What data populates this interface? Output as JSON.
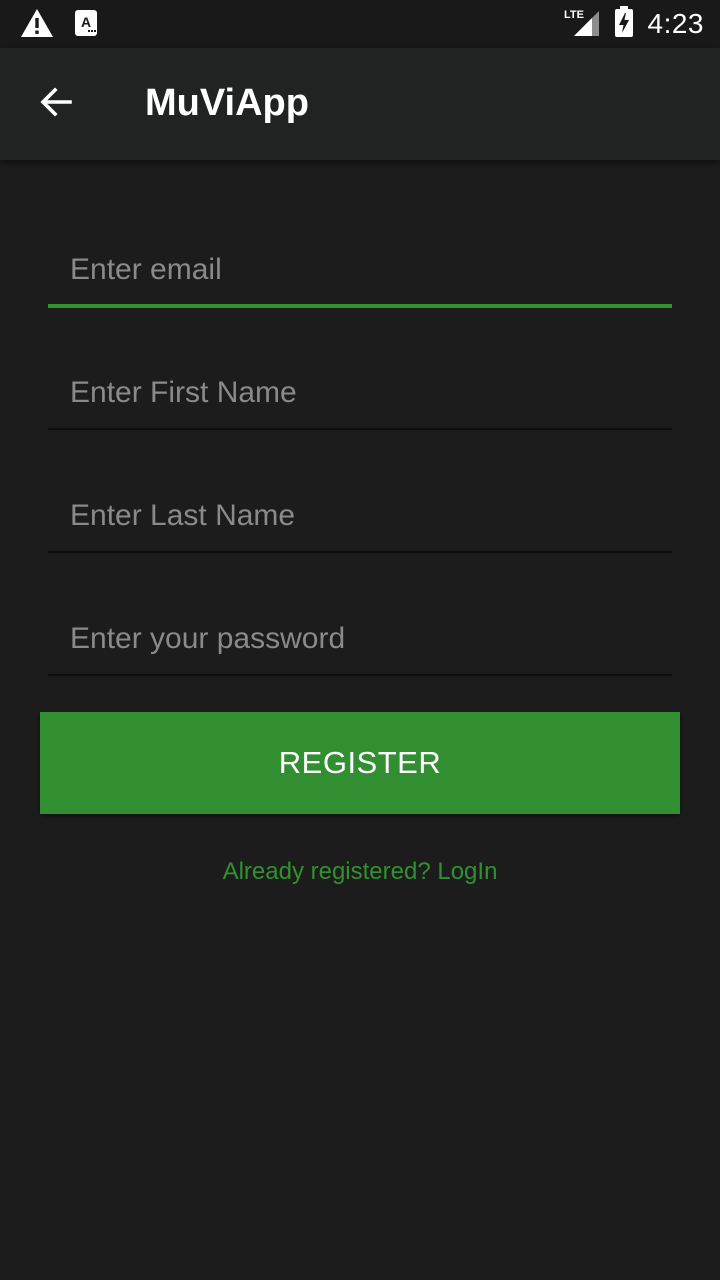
{
  "status_bar": {
    "time": "4:23",
    "network": "LTE",
    "icons": [
      "warning-icon",
      "app-notification-icon",
      "lte-signal-icon",
      "battery-charging-icon"
    ]
  },
  "app_bar": {
    "title": "MuViApp",
    "back_icon": "arrow-back-icon"
  },
  "form": {
    "email_placeholder": "Enter email",
    "first_name_placeholder": "Enter First Name",
    "last_name_placeholder": "Enter Last Name",
    "password_placeholder": "Enter your password",
    "register_label": "REGISTER",
    "login_link": "Already registered? LogIn"
  },
  "colors": {
    "background": "#1c1c1c",
    "status_bar": "#191919",
    "app_bar": "#212323",
    "accent": "#318f31",
    "link": "#2f922f",
    "placeholder": "#8a8a8a"
  }
}
